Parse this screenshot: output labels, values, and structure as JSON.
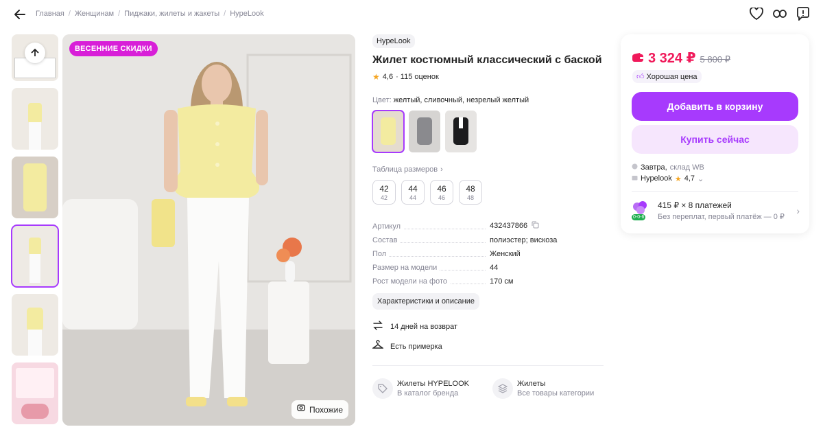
{
  "breadcrumbs": [
    "Главная",
    "Женщинам",
    "Пиджаки, жилеты и жакеты",
    "HypeLook"
  ],
  "gallery": {
    "promo_badge": "ВЕСЕННИЕ СКИДКИ",
    "similar_label": "Похожие"
  },
  "product": {
    "brand": "HypeLook",
    "title": "Жилет костюмный классический с баской",
    "rating": "4,6",
    "reviews": "· 115 оценок",
    "color_label": "Цвет:",
    "color_value": "желтый, сливочный, незрелый желтый",
    "size_table_label": "Таблица размеров",
    "sizes": [
      {
        "main": "42",
        "ru": "42"
      },
      {
        "main": "44",
        "ru": "44"
      },
      {
        "main": "46",
        "ru": "46"
      },
      {
        "main": "48",
        "ru": "48"
      }
    ],
    "specs": [
      {
        "key": "Артикул",
        "value": "432437866"
      },
      {
        "key": "Состав",
        "value": "полиэстер; вискоза"
      },
      {
        "key": "Пол",
        "value": "Женский"
      },
      {
        "key": "Размер на модели",
        "value": "44"
      },
      {
        "key": "Рост модели на фото",
        "value": "170 см"
      }
    ],
    "chars_button": "Характеристики и описание",
    "features": [
      {
        "icon": "return-arrows-icon",
        "text": "14 дней на возврат"
      },
      {
        "icon": "hanger-icon",
        "text": "Есть примерка"
      }
    ],
    "categories": [
      {
        "icon": "tag-icon",
        "title": "Жилеты HYPELOOK",
        "subtitle": "В каталог бренда"
      },
      {
        "icon": "stack-icon",
        "title": "Жилеты",
        "subtitle": "Все товары категории"
      }
    ]
  },
  "buy_box": {
    "price": "3 324 ₽",
    "old_price": "5 800 ₽",
    "good_price": "Хорошая цена",
    "add_to_cart": "Добавить в корзину",
    "buy_now": "Купить сейчас",
    "delivery_day": "Завтра,",
    "delivery_warehouse": "склад WB",
    "seller": "Hypelook",
    "seller_rating": "4,7",
    "installment_title": "415 ₽ × 8 платежей",
    "installment_subtitle": "Без переплат, первый платёж — 0 ₽",
    "installment_badge": "0-0-6"
  },
  "colors": {
    "accent": "#a73afd",
    "price": "#f0195a",
    "promo": "#d81fd8",
    "vest_yellow": "#f3eba0"
  }
}
